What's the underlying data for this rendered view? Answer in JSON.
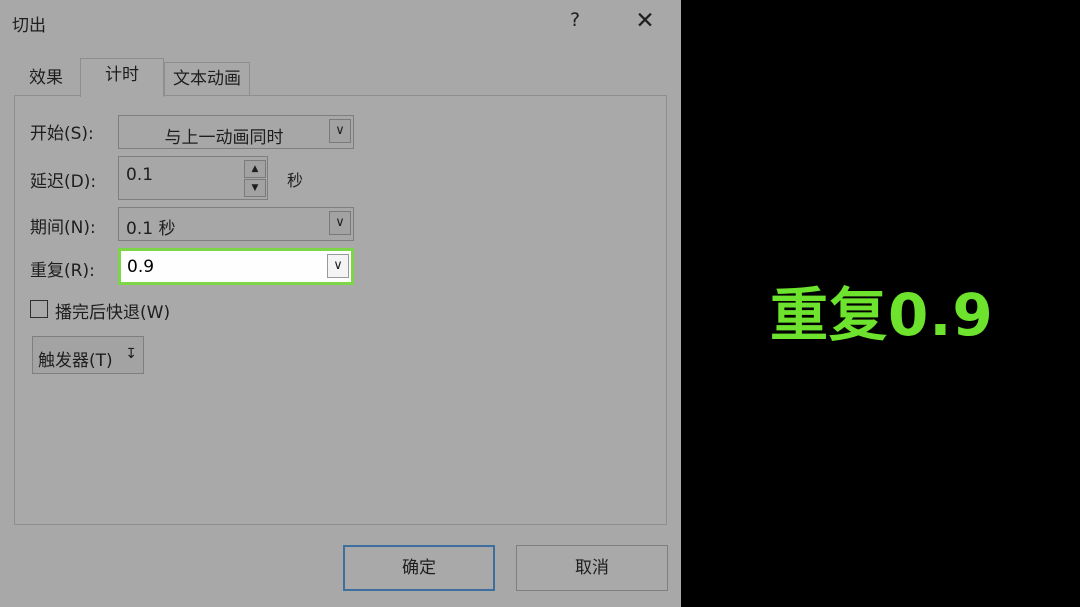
{
  "dialog": {
    "title": "切出",
    "help_label": "?",
    "close_label": "✕",
    "tabs": [
      {
        "label": "效果"
      },
      {
        "label": "计时"
      },
      {
        "label": "文本动画"
      }
    ],
    "start": {
      "label": "开始(S):",
      "value": "与上一动画同时"
    },
    "delay": {
      "label": "延迟(D):",
      "value": "0.1",
      "unit": "秒"
    },
    "duration": {
      "label": "期间(N):",
      "value": "0.1 秒"
    },
    "repeat": {
      "label": "重复(R):",
      "value": "0.9"
    },
    "rewind": {
      "label": "播完后快退(W)",
      "checked": false
    },
    "trigger": {
      "label": "触发器(T)",
      "icon": "double-chevron-down-icon"
    },
    "ok_label": "确定",
    "cancel_label": "取消"
  },
  "caption": {
    "text": "重复0.9",
    "color": "#6de32e"
  },
  "colors": {
    "highlight_border": "#7cd648",
    "ok_border": "#3e6e9e"
  }
}
